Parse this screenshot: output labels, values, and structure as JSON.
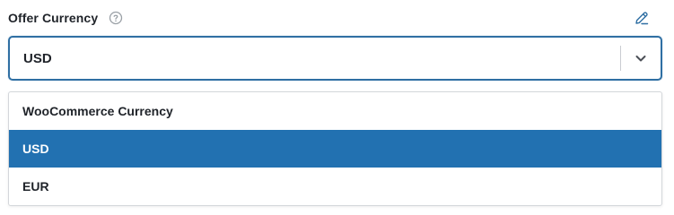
{
  "field": {
    "label": "Offer Currency",
    "help_icon": "question-circle-icon",
    "edit_icon": "pencil-icon"
  },
  "select": {
    "value": "USD",
    "dropdown_icon": "chevron-down-icon"
  },
  "options": [
    {
      "label": "WooCommerce Currency",
      "selected": false
    },
    {
      "label": "USD",
      "selected": true
    },
    {
      "label": "EUR",
      "selected": false
    }
  ],
  "colors": {
    "accent": "#2271b1",
    "focus_border": "#2f6fa3",
    "icon_gray": "#9aa0a6"
  }
}
